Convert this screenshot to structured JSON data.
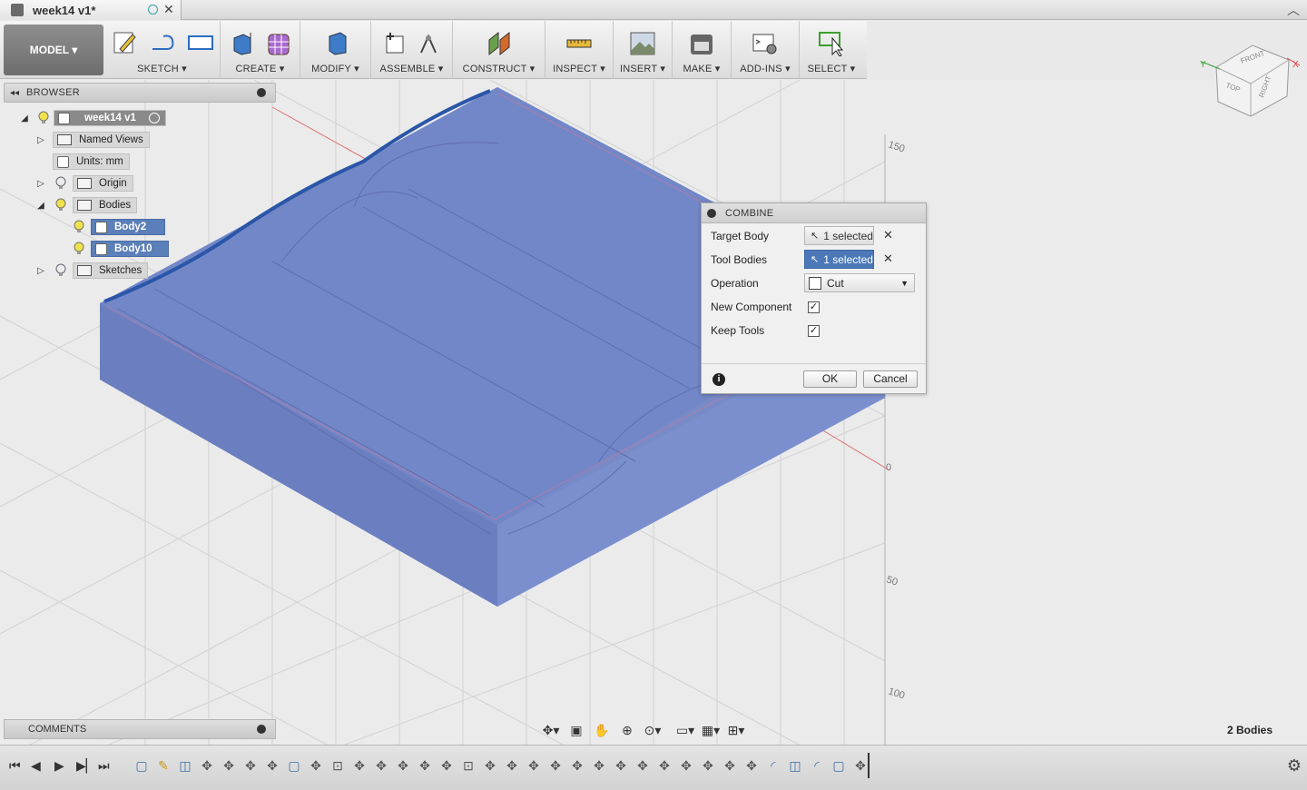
{
  "document": {
    "title": "week14 v1*"
  },
  "toolbar": {
    "workspace_label": "MODEL ▾",
    "groups": [
      {
        "label": "SKETCH ▾"
      },
      {
        "label": "CREATE ▾"
      },
      {
        "label": "MODIFY ▾"
      },
      {
        "label": "ASSEMBLE ▾"
      },
      {
        "label": "CONSTRUCT ▾"
      },
      {
        "label": "INSPECT ▾"
      },
      {
        "label": "INSERT ▾"
      },
      {
        "label": "MAKE ▾"
      },
      {
        "label": "ADD-INS ▾"
      },
      {
        "label": "SELECT ▾"
      }
    ]
  },
  "browser": {
    "title": "BROWSER",
    "root": "week14 v1",
    "items": [
      {
        "label": "Named Views"
      },
      {
        "label": "Units: mm"
      },
      {
        "label": "Origin"
      },
      {
        "label": "Bodies"
      },
      {
        "label": "Body2"
      },
      {
        "label": "Body10"
      },
      {
        "label": "Sketches"
      }
    ]
  },
  "comments": {
    "title": "COMMENTS"
  },
  "status": {
    "bodies_count": "2 Bodies"
  },
  "ruler": {
    "labels": [
      "150",
      "0",
      "50",
      "100"
    ]
  },
  "combine": {
    "title": "COMBINE",
    "target_body_label": "Target Body",
    "target_body_value": "1 selected",
    "tool_bodies_label": "Tool Bodies",
    "tool_bodies_value": "1 selected",
    "operation_label": "Operation",
    "operation_value": "Cut",
    "new_component_label": "New Component",
    "new_component_checked": true,
    "keep_tools_label": "Keep Tools",
    "keep_tools_checked": true,
    "ok_label": "OK",
    "cancel_label": "Cancel",
    "check_glyph": "✓"
  },
  "viewcube": {
    "top": "TOP",
    "front": "FRONT",
    "right": "RIGHT"
  },
  "colors": {
    "body_fill": "#6f83c4",
    "selection": "#4c78b8"
  }
}
